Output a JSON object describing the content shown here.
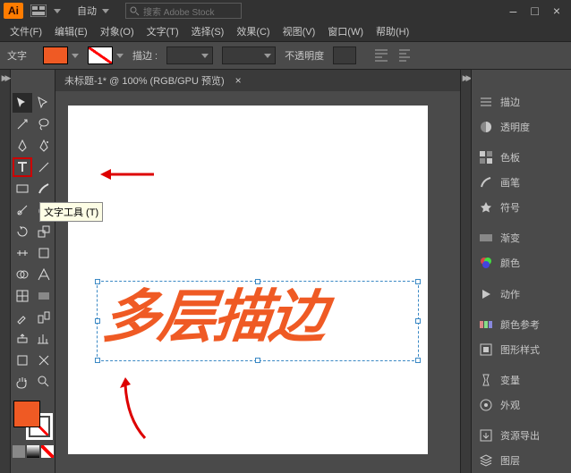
{
  "app_logo": "Ai",
  "layout_preset": "自动",
  "stock_placeholder": "搜索 Adobe Stock",
  "window_buttons": {
    "min": "–",
    "max": "□",
    "close": "×"
  },
  "menu": [
    "文件(F)",
    "编辑(E)",
    "对象(O)",
    "文字(T)",
    "选择(S)",
    "效果(C)",
    "视图(V)",
    "窗口(W)",
    "帮助(H)"
  ],
  "control": {
    "context": "文字",
    "stroke_label": "描边 :",
    "opacity_label": "不透明度"
  },
  "tooltip": "文字工具 (T)",
  "doc": {
    "title": "未标题-1* @ 100% (RGB/GPU 预览)",
    "close": "×"
  },
  "artwork_text": "多层描边",
  "panels": [
    "描边",
    "透明度",
    "色板",
    "画笔",
    "符号",
    "渐变",
    "颜色",
    "动作",
    "颜色参考",
    "图形样式",
    "变量",
    "外观",
    "资源导出",
    "图层"
  ],
  "colors": {
    "accent": "#ef5a24",
    "logo": "#ff7c00"
  }
}
